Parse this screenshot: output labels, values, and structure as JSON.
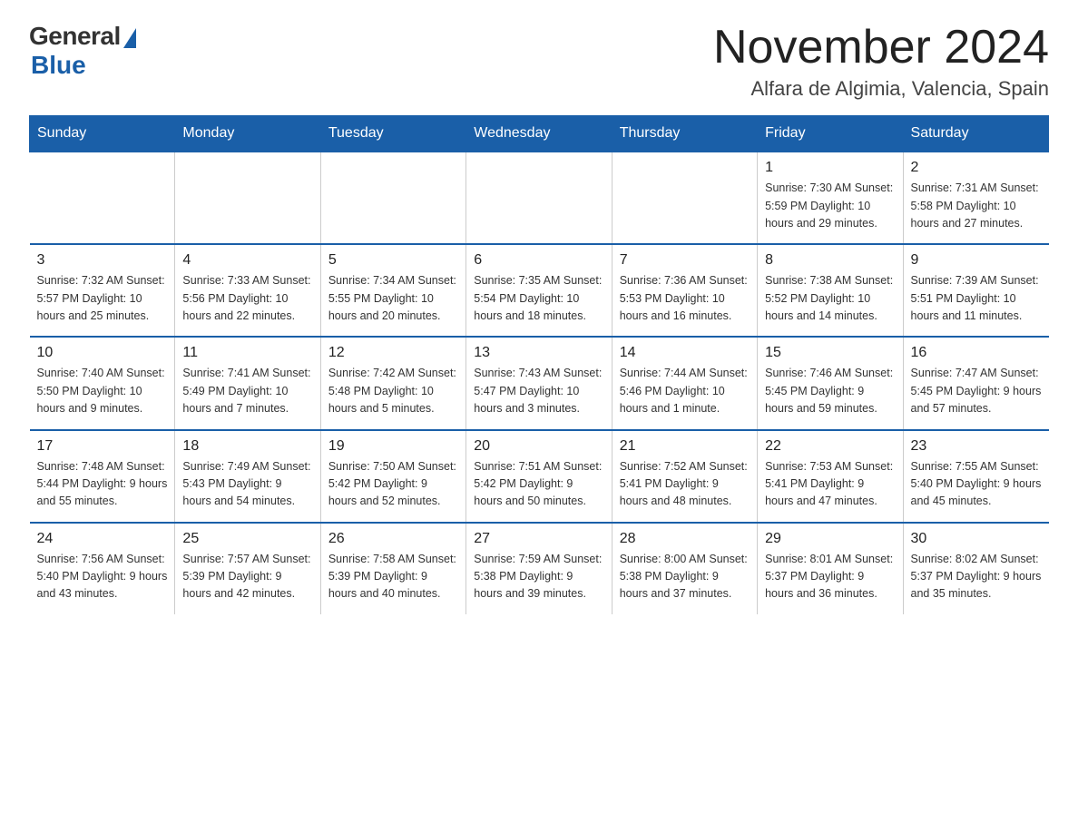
{
  "header": {
    "logo_general": "General",
    "logo_blue": "Blue",
    "month_title": "November 2024",
    "location": "Alfara de Algimia, Valencia, Spain"
  },
  "weekdays": [
    "Sunday",
    "Monday",
    "Tuesday",
    "Wednesday",
    "Thursday",
    "Friday",
    "Saturday"
  ],
  "weeks": [
    [
      {
        "day": "",
        "info": ""
      },
      {
        "day": "",
        "info": ""
      },
      {
        "day": "",
        "info": ""
      },
      {
        "day": "",
        "info": ""
      },
      {
        "day": "",
        "info": ""
      },
      {
        "day": "1",
        "info": "Sunrise: 7:30 AM\nSunset: 5:59 PM\nDaylight: 10 hours\nand 29 minutes."
      },
      {
        "day": "2",
        "info": "Sunrise: 7:31 AM\nSunset: 5:58 PM\nDaylight: 10 hours\nand 27 minutes."
      }
    ],
    [
      {
        "day": "3",
        "info": "Sunrise: 7:32 AM\nSunset: 5:57 PM\nDaylight: 10 hours\nand 25 minutes."
      },
      {
        "day": "4",
        "info": "Sunrise: 7:33 AM\nSunset: 5:56 PM\nDaylight: 10 hours\nand 22 minutes."
      },
      {
        "day": "5",
        "info": "Sunrise: 7:34 AM\nSunset: 5:55 PM\nDaylight: 10 hours\nand 20 minutes."
      },
      {
        "day": "6",
        "info": "Sunrise: 7:35 AM\nSunset: 5:54 PM\nDaylight: 10 hours\nand 18 minutes."
      },
      {
        "day": "7",
        "info": "Sunrise: 7:36 AM\nSunset: 5:53 PM\nDaylight: 10 hours\nand 16 minutes."
      },
      {
        "day": "8",
        "info": "Sunrise: 7:38 AM\nSunset: 5:52 PM\nDaylight: 10 hours\nand 14 minutes."
      },
      {
        "day": "9",
        "info": "Sunrise: 7:39 AM\nSunset: 5:51 PM\nDaylight: 10 hours\nand 11 minutes."
      }
    ],
    [
      {
        "day": "10",
        "info": "Sunrise: 7:40 AM\nSunset: 5:50 PM\nDaylight: 10 hours\nand 9 minutes."
      },
      {
        "day": "11",
        "info": "Sunrise: 7:41 AM\nSunset: 5:49 PM\nDaylight: 10 hours\nand 7 minutes."
      },
      {
        "day": "12",
        "info": "Sunrise: 7:42 AM\nSunset: 5:48 PM\nDaylight: 10 hours\nand 5 minutes."
      },
      {
        "day": "13",
        "info": "Sunrise: 7:43 AM\nSunset: 5:47 PM\nDaylight: 10 hours\nand 3 minutes."
      },
      {
        "day": "14",
        "info": "Sunrise: 7:44 AM\nSunset: 5:46 PM\nDaylight: 10 hours\nand 1 minute."
      },
      {
        "day": "15",
        "info": "Sunrise: 7:46 AM\nSunset: 5:45 PM\nDaylight: 9 hours\nand 59 minutes."
      },
      {
        "day": "16",
        "info": "Sunrise: 7:47 AM\nSunset: 5:45 PM\nDaylight: 9 hours\nand 57 minutes."
      }
    ],
    [
      {
        "day": "17",
        "info": "Sunrise: 7:48 AM\nSunset: 5:44 PM\nDaylight: 9 hours\nand 55 minutes."
      },
      {
        "day": "18",
        "info": "Sunrise: 7:49 AM\nSunset: 5:43 PM\nDaylight: 9 hours\nand 54 minutes."
      },
      {
        "day": "19",
        "info": "Sunrise: 7:50 AM\nSunset: 5:42 PM\nDaylight: 9 hours\nand 52 minutes."
      },
      {
        "day": "20",
        "info": "Sunrise: 7:51 AM\nSunset: 5:42 PM\nDaylight: 9 hours\nand 50 minutes."
      },
      {
        "day": "21",
        "info": "Sunrise: 7:52 AM\nSunset: 5:41 PM\nDaylight: 9 hours\nand 48 minutes."
      },
      {
        "day": "22",
        "info": "Sunrise: 7:53 AM\nSunset: 5:41 PM\nDaylight: 9 hours\nand 47 minutes."
      },
      {
        "day": "23",
        "info": "Sunrise: 7:55 AM\nSunset: 5:40 PM\nDaylight: 9 hours\nand 45 minutes."
      }
    ],
    [
      {
        "day": "24",
        "info": "Sunrise: 7:56 AM\nSunset: 5:40 PM\nDaylight: 9 hours\nand 43 minutes."
      },
      {
        "day": "25",
        "info": "Sunrise: 7:57 AM\nSunset: 5:39 PM\nDaylight: 9 hours\nand 42 minutes."
      },
      {
        "day": "26",
        "info": "Sunrise: 7:58 AM\nSunset: 5:39 PM\nDaylight: 9 hours\nand 40 minutes."
      },
      {
        "day": "27",
        "info": "Sunrise: 7:59 AM\nSunset: 5:38 PM\nDaylight: 9 hours\nand 39 minutes."
      },
      {
        "day": "28",
        "info": "Sunrise: 8:00 AM\nSunset: 5:38 PM\nDaylight: 9 hours\nand 37 minutes."
      },
      {
        "day": "29",
        "info": "Sunrise: 8:01 AM\nSunset: 5:37 PM\nDaylight: 9 hours\nand 36 minutes."
      },
      {
        "day": "30",
        "info": "Sunrise: 8:02 AM\nSunset: 5:37 PM\nDaylight: 9 hours\nand 35 minutes."
      }
    ]
  ]
}
